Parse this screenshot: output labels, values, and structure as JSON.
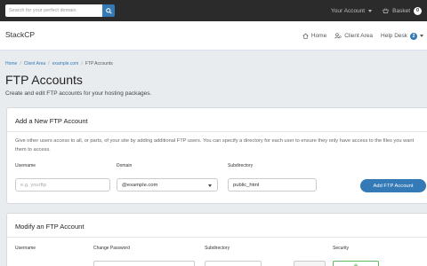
{
  "topbar": {
    "search_placeholder": "Search for your perfect domain",
    "account_label": "Your Account",
    "basket_label": "Basket",
    "basket_count": "0"
  },
  "header": {
    "logo": "StackCP",
    "nav": {
      "home": "Home",
      "client_area": "Client Area",
      "help_desk": "Help Desk",
      "help_badge": "2"
    }
  },
  "breadcrumb": [
    "Home",
    "Client Area",
    "example.com",
    "FTP Accounts"
  ],
  "page": {
    "title": "FTP Accounts",
    "subtitle": "Create and edit FTP accounts for your hosting packages."
  },
  "add_card": {
    "title": "Add a New FTP Account",
    "description": "Give other users access to all, or parts, of your site by adding additional FTP users. You can specify a directory for each user to ensure they only have access to the files you want them to access.",
    "labels": {
      "username": "Username",
      "domain": "Domain",
      "subdirectory": "Subdirectory"
    },
    "username_placeholder": "e.g. yourftp",
    "domain_value": "@example.com",
    "subdirectory_value": "public_html",
    "button": "Add FTP Account"
  },
  "modify_card": {
    "title": "Modify an FTP Account",
    "columns": [
      "Username",
      "Change Password",
      "Subdirectory",
      "Security"
    ]
  },
  "colors": {
    "accent": "#337ab7",
    "topbar": "#2b2b2b"
  }
}
